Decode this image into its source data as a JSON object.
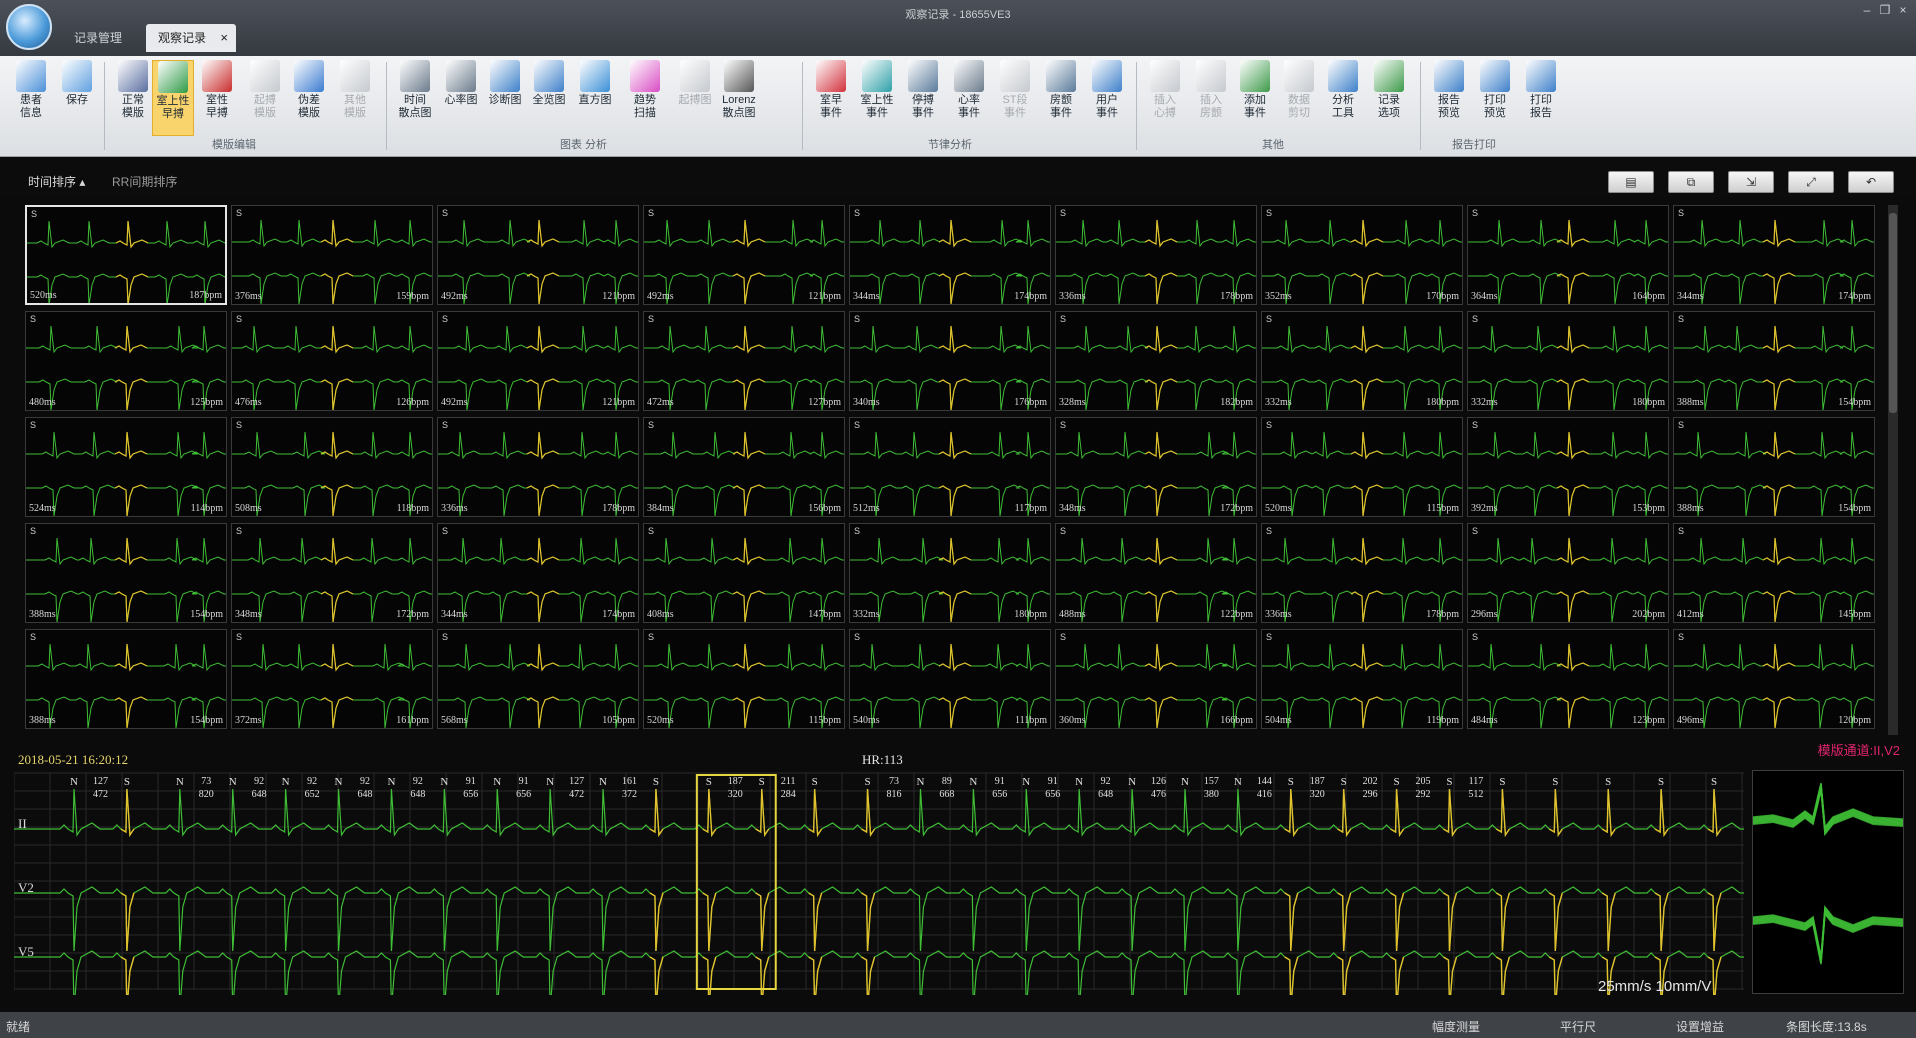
{
  "window": {
    "title": "观察记录 - 18655VE3"
  },
  "tabs": [
    {
      "label": "记录管理"
    },
    {
      "label": "观察记录"
    }
  ],
  "ribbon": {
    "buttons": [
      {
        "label": "患者\n信息",
        "icon": "patient-info-icon"
      },
      {
        "label": "保存",
        "icon": "save-icon"
      },
      {
        "label": "正常\n模版",
        "icon": "normal-template-icon"
      },
      {
        "label": "室上性\n早搏",
        "icon": "sve-icon"
      },
      {
        "label": "室性\n早搏",
        "icon": "ve-icon"
      },
      {
        "label": "起搏\n模版",
        "icon": "pacing-template-icon"
      },
      {
        "label": "伪差\n模版",
        "icon": "artifact-template-icon"
      },
      {
        "label": "其他\n模版",
        "icon": "other-template-icon"
      },
      {
        "label": "时间\n散点图",
        "icon": "time-scatter-icon"
      },
      {
        "label": "心率图",
        "icon": "hr-chart-icon"
      },
      {
        "label": "诊断图",
        "icon": "diagnosis-chart-icon"
      },
      {
        "label": "全览图",
        "icon": "overview-chart-icon"
      },
      {
        "label": "直方图",
        "icon": "histogram-icon"
      },
      {
        "label": "趋势\n扫描",
        "icon": "trend-scan-icon"
      },
      {
        "label": "起搏图",
        "icon": "pacing-chart-icon"
      },
      {
        "label": "Lorenz\n散点图",
        "icon": "lorenz-icon"
      },
      {
        "label": "室早\n事件",
        "icon": "ve-event-icon"
      },
      {
        "label": "室上性\n事件",
        "icon": "sve-event-icon"
      },
      {
        "label": "停搏\n事件",
        "icon": "pause-event-icon"
      },
      {
        "label": "心率\n事件",
        "icon": "hr-event-icon"
      },
      {
        "label": "ST段\n事件",
        "icon": "st-event-icon"
      },
      {
        "label": "房颤\n事件",
        "icon": "af-event-icon"
      },
      {
        "label": "用户\n事件",
        "icon": "user-event-icon"
      },
      {
        "label": "插入\n心搏",
        "icon": "insert-beat-icon"
      },
      {
        "label": "插入\n房颤",
        "icon": "insert-af-icon"
      },
      {
        "label": "添加\n事件",
        "icon": "add-event-icon"
      },
      {
        "label": "数据\n剪切",
        "icon": "cut-icon"
      },
      {
        "label": "分析\n工具",
        "icon": "analysis-tool-icon"
      },
      {
        "label": "记录\n选项",
        "icon": "record-options-icon"
      },
      {
        "label": "报告\n预览",
        "icon": "report-preview-icon"
      },
      {
        "label": "打印\n预览",
        "icon": "print-preview-icon"
      },
      {
        "label": "打印\n报告",
        "icon": "print-report-icon"
      }
    ],
    "groups": [
      {
        "label": "模版编辑"
      },
      {
        "label": "图表 分析"
      },
      {
        "label": "节律分析"
      },
      {
        "label": "其他"
      },
      {
        "label": "报告打印"
      }
    ]
  },
  "sort": {
    "time": "时间排序",
    "rr": "RR间期排序"
  },
  "beats": [
    {
      "rr": "520ms",
      "hr": "187bpm"
    },
    {
      "rr": "376ms",
      "hr": "159bpm"
    },
    {
      "rr": "492ms",
      "hr": "121bpm"
    },
    {
      "rr": "492ms",
      "hr": "121bpm"
    },
    {
      "rr": "344ms",
      "hr": "174bpm"
    },
    {
      "rr": "336ms",
      "hr": "178bpm"
    },
    {
      "rr": "352ms",
      "hr": "170bpm"
    },
    {
      "rr": "364ms",
      "hr": "164bpm"
    },
    {
      "rr": "344ms",
      "hr": "174bpm"
    },
    {
      "rr": "480ms",
      "hr": "125bpm"
    },
    {
      "rr": "476ms",
      "hr": "126bpm"
    },
    {
      "rr": "492ms",
      "hr": "121bpm"
    },
    {
      "rr": "472ms",
      "hr": "127bpm"
    },
    {
      "rr": "340ms",
      "hr": "176bpm"
    },
    {
      "rr": "328ms",
      "hr": "182bpm"
    },
    {
      "rr": "332ms",
      "hr": "180bpm"
    },
    {
      "rr": "332ms",
      "hr": "180bpm"
    },
    {
      "rr": "388ms",
      "hr": "154bpm"
    },
    {
      "rr": "524ms",
      "hr": "114bpm"
    },
    {
      "rr": "508ms",
      "hr": "118bpm"
    },
    {
      "rr": "336ms",
      "hr": "178bpm"
    },
    {
      "rr": "384ms",
      "hr": "156bpm"
    },
    {
      "rr": "512ms",
      "hr": "117bpm"
    },
    {
      "rr": "348ms",
      "hr": "172bpm"
    },
    {
      "rr": "520ms",
      "hr": "115bpm"
    },
    {
      "rr": "392ms",
      "hr": "153bpm"
    },
    {
      "rr": "388ms",
      "hr": "154bpm"
    },
    {
      "rr": "388ms",
      "hr": "154bpm"
    },
    {
      "rr": "348ms",
      "hr": "172bpm"
    },
    {
      "rr": "344ms",
      "hr": "174bpm"
    },
    {
      "rr": "408ms",
      "hr": "147bpm"
    },
    {
      "rr": "332ms",
      "hr": "180bpm"
    },
    {
      "rr": "488ms",
      "hr": "122bpm"
    },
    {
      "rr": "336ms",
      "hr": "178bpm"
    },
    {
      "rr": "296ms",
      "hr": "202bpm"
    },
    {
      "rr": "412ms",
      "hr": "145bpm"
    },
    {
      "rr": "388ms",
      "hr": "154bpm"
    },
    {
      "rr": "372ms",
      "hr": "161bpm"
    },
    {
      "rr": "568ms",
      "hr": "105bpm"
    },
    {
      "rr": "520ms",
      "hr": "115bpm"
    },
    {
      "rr": "540ms",
      "hr": "111bpm"
    },
    {
      "rr": "360ms",
      "hr": "166bpm"
    },
    {
      "rr": "504ms",
      "hr": "119bpm"
    },
    {
      "rr": "484ms",
      "hr": "123bpm"
    },
    {
      "rr": "496ms",
      "hr": "120bpm"
    }
  ],
  "strip": {
    "datetime": "2018-05-21 16:20:12",
    "hr": "HR:113",
    "channels_label": "模版通道:II,V2",
    "leads": [
      "II",
      "V2",
      "V5"
    ],
    "speed": "25mm/s 10mm/V",
    "beat_types": [
      "N",
      "S",
      "N",
      "N",
      "N",
      "N",
      "N",
      "N",
      "N",
      "N",
      "N",
      "S",
      "S",
      "S",
      "S",
      "S",
      "N",
      "N",
      "N",
      "N",
      "N",
      "N",
      "N",
      "S",
      "S",
      "S",
      "S",
      "S",
      "S",
      "S",
      "S",
      "S"
    ],
    "hr_values": [
      "127",
      "",
      "73",
      "92",
      "92",
      "92",
      "92",
      "91",
      "91",
      "127",
      "161",
      "",
      "187",
      "211",
      "",
      "73",
      "89",
      "91",
      "91",
      "92",
      "126",
      "157",
      "144",
      "187",
      "202",
      "205",
      "117",
      "",
      "",
      "",
      "",
      ""
    ],
    "rr_values": [
      "472",
      "",
      "820",
      "648",
      "652",
      "648",
      "648",
      "656",
      "656",
      "472",
      "372",
      "",
      "320",
      "284",
      "",
      "816",
      "668",
      "656",
      "656",
      "648",
      "476",
      "380",
      "416",
      "320",
      "296",
      "292",
      "512",
      "",
      "",
      "",
      "",
      ""
    ]
  },
  "status": {
    "ready": "就绪",
    "measure": "幅度测量",
    "ruler": "平行尺",
    "gain": "设置增益",
    "strip_len": "条图长度:13.8s"
  },
  "colors": {
    "normal": "#3fbe36",
    "sve": "#e3c12e",
    "selected_box": "#e6d640"
  }
}
